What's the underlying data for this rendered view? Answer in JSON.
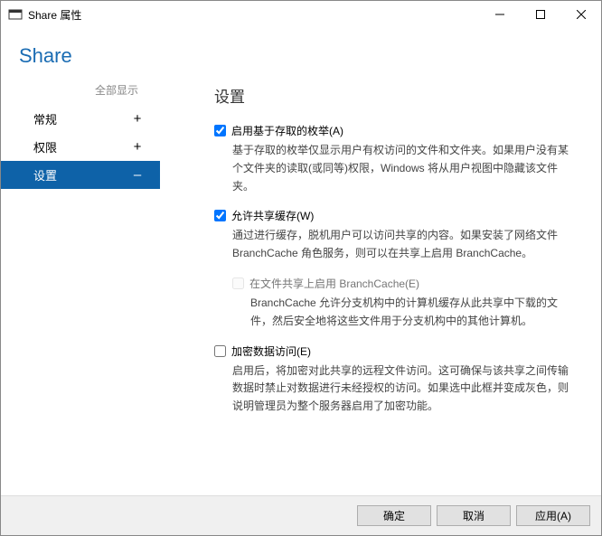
{
  "titlebar": {
    "title": "Share 属性"
  },
  "header": {
    "title": "Share"
  },
  "sidebar": {
    "show_all": "全部显示",
    "items": [
      {
        "label": "常规",
        "sign": "+"
      },
      {
        "label": "权限",
        "sign": "+"
      },
      {
        "label": "设置",
        "sign": "–"
      }
    ]
  },
  "content": {
    "title": "设置",
    "opt1": {
      "label": "启用基于存取的枚举(A)",
      "desc": "基于存取的枚举仅显示用户有权访问的文件和文件夹。如果用户没有某个文件夹的读取(或同等)权限，Windows 将从用户视图中隐藏该文件夹。"
    },
    "opt2": {
      "label": "允许共享缓存(W)",
      "desc": "通过进行缓存，脱机用户可以访问共享的内容。如果安装了网络文件 BranchCache 角色服务，则可以在共享上启用 BranchCache。",
      "sub": {
        "label": "在文件共享上启用 BranchCache(E)",
        "desc": "BranchCache 允许分支机构中的计算机缓存从此共享中下载的文件，然后安全地将这些文件用于分支机构中的其他计算机。"
      }
    },
    "opt3": {
      "label": "加密数据访问(E)",
      "desc": "启用后，将加密对此共享的远程文件访问。这可确保与该共享之间传输数据时禁止对数据进行未经授权的访问。如果选中此框并变成灰色，则说明管理员为整个服务器启用了加密功能。"
    }
  },
  "footer": {
    "ok": "确定",
    "cancel": "取消",
    "apply": "应用(A)"
  }
}
